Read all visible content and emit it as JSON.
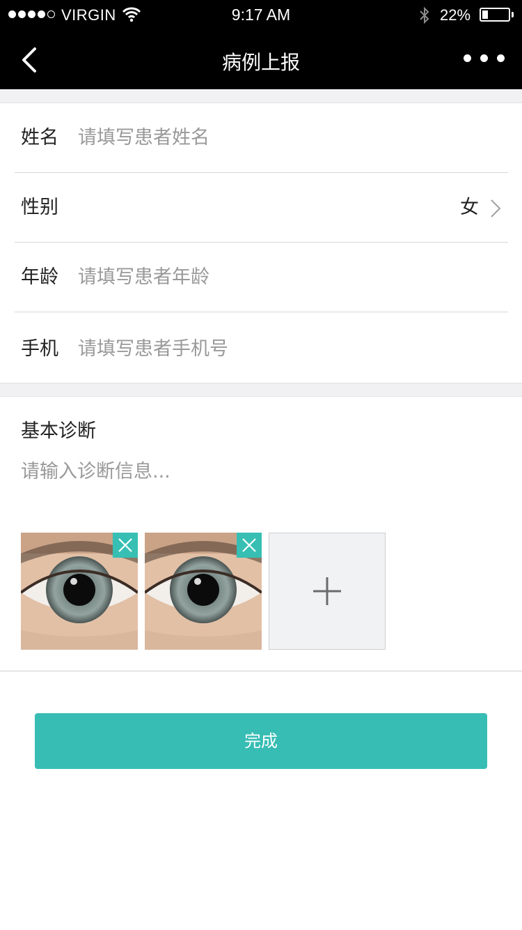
{
  "status_bar": {
    "carrier": "VIRGIN",
    "time": "9:17 AM",
    "battery_percent": "22%",
    "battery_level": 0.22,
    "signal_bars_filled": 4,
    "signal_bars_total": 5,
    "icons": [
      "wifi-icon",
      "bluetooth-icon",
      "battery-icon"
    ]
  },
  "nav": {
    "title": "病例上报",
    "back_icon": "chevron-left-icon",
    "more_icon": "more-dots-icon"
  },
  "form": {
    "name": {
      "label": "姓名",
      "placeholder": "请填写患者姓名"
    },
    "gender": {
      "label": "性别",
      "value": "女",
      "icon": "chevron-right-icon"
    },
    "age": {
      "label": "年龄",
      "placeholder": "请填写患者年龄"
    },
    "phone": {
      "label": "手机",
      "placeholder": "请填写患者手机号"
    }
  },
  "diagnosis": {
    "label": "基本诊断",
    "placeholder": "请输入诊断信息..."
  },
  "photos": {
    "items": [
      "eye-photo",
      "eye-photo"
    ],
    "remove_icon": "close-icon",
    "add_icon": "plus-icon"
  },
  "submit": {
    "label": "完成"
  },
  "colors": {
    "accent": "#37bdb4",
    "bar_background": "#000000",
    "separator": "#f1f1f3",
    "placeholder_text": "#999999"
  }
}
